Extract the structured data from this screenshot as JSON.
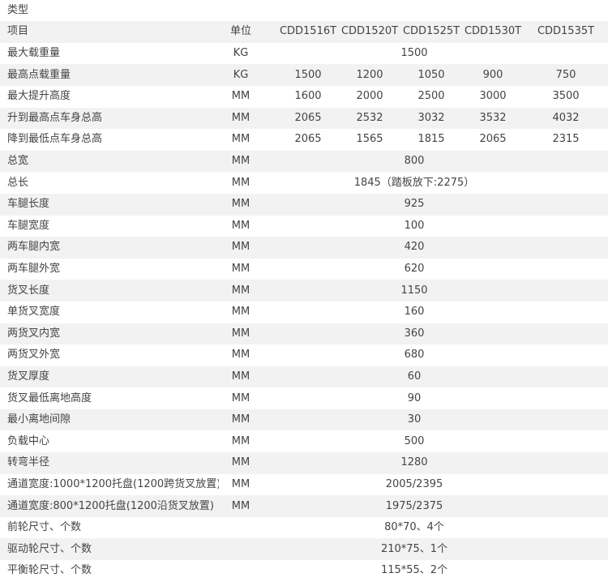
{
  "title": "类型",
  "header": {
    "item": "项目",
    "unit": "单位",
    "models": [
      "CDD1516T",
      "CDD1520T",
      "CDD1525T",
      "CDD1530T",
      "CDD1535T"
    ]
  },
  "rows": [
    {
      "name": "最大载重量",
      "unit": "KG",
      "shared": "1500"
    },
    {
      "name": "最高点载重量",
      "unit": "KG",
      "values": [
        "1500",
        "1200",
        "1050",
        "900",
        "750"
      ]
    },
    {
      "name": "最大提升高度",
      "unit": "MM",
      "values": [
        "1600",
        "2000",
        "2500",
        "3000",
        "3500"
      ]
    },
    {
      "name": "升到最高点车身总高",
      "unit": "MM",
      "values": [
        "2065",
        "2532",
        "3032",
        "3532",
        "4032"
      ]
    },
    {
      "name": "降到最低点车身总高",
      "unit": "MM",
      "values": [
        "2065",
        "1565",
        "1815",
        "2065",
        "2315"
      ]
    },
    {
      "name": "总宽",
      "unit": "MM",
      "shared": "800"
    },
    {
      "name": "总长",
      "unit": "MM",
      "shared": "1845（踏板放下:2275）"
    },
    {
      "name": "车腿长度",
      "unit": "MM",
      "shared": "925"
    },
    {
      "name": "车腿宽度",
      "unit": "MM",
      "shared": "100"
    },
    {
      "name": "两车腿内宽",
      "unit": "MM",
      "shared": "420"
    },
    {
      "name": "两车腿外宽",
      "unit": "MM",
      "shared": "620"
    },
    {
      "name": "货叉长度",
      "unit": "MM",
      "shared": "1150"
    },
    {
      "name": "单货叉宽度",
      "unit": "MM",
      "shared": "160"
    },
    {
      "name": "两货叉内宽",
      "unit": "MM",
      "shared": "360"
    },
    {
      "name": "两货叉外宽",
      "unit": "MM",
      "shared": "680"
    },
    {
      "name": "货叉厚度",
      "unit": "MM",
      "shared": "60"
    },
    {
      "name": "货叉最低离地高度",
      "unit": "MM",
      "shared": "90"
    },
    {
      "name": "最小离地间隙",
      "unit": "MM",
      "shared": "30"
    },
    {
      "name": "负载中心",
      "unit": "MM",
      "shared": "500"
    },
    {
      "name": "转弯半径",
      "unit": "MM",
      "shared": "1280"
    },
    {
      "name": "通道宽度:1000*1200托盘(1200跨货叉放置)",
      "unit": "MM",
      "shared": "2005/2395"
    },
    {
      "name": "通道宽度:800*1200托盘(1200沿货叉放置)",
      "unit": "MM",
      "shared": "1975/2375"
    },
    {
      "name": "前轮尺寸、个数",
      "unit": "",
      "shared": "80*70、4个"
    },
    {
      "name": "驱动轮尺寸、个数",
      "unit": "",
      "shared": "210*75、1个"
    },
    {
      "name": "平衡轮尺寸、个数",
      "unit": "",
      "shared": "115*55、2个"
    }
  ]
}
